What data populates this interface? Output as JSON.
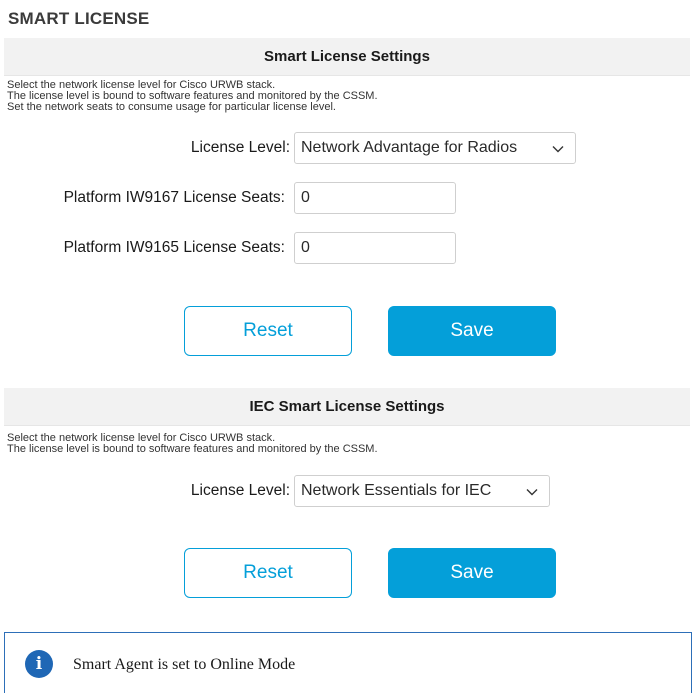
{
  "page": {
    "title": "SMART LICENSE"
  },
  "smart_license": {
    "header": "Smart License Settings",
    "description": [
      "Select the network license level for Cisco URWB stack.",
      "The license level is bound to software features and monitored by the CSSM.",
      "Set the network seats to consume usage for particular license level."
    ],
    "license_level_label": "License Level:",
    "license_level_value": "Network Advantage for Radios",
    "iw9167_label": "Platform IW9167 License Seats:",
    "iw9167_value": "0",
    "iw9165_label": "Platform IW9165 License Seats:",
    "iw9165_value": "0",
    "reset_label": "Reset",
    "save_label": "Save"
  },
  "iec_license": {
    "header": "IEC Smart License Settings",
    "description": [
      "Select the network license level for Cisco URWB stack.",
      "The license level is bound to software features and monitored by the CSSM."
    ],
    "license_level_label": "License Level:",
    "license_level_value": "Network Essentials for IEC",
    "reset_label": "Reset",
    "save_label": "Save"
  },
  "info": {
    "icon": "info-icon",
    "text": "Smart Agent is set to Online Mode"
  },
  "colors": {
    "accent": "#049fd9",
    "info_blue": "#1f67b5",
    "header_bg": "#f2f2f2"
  }
}
